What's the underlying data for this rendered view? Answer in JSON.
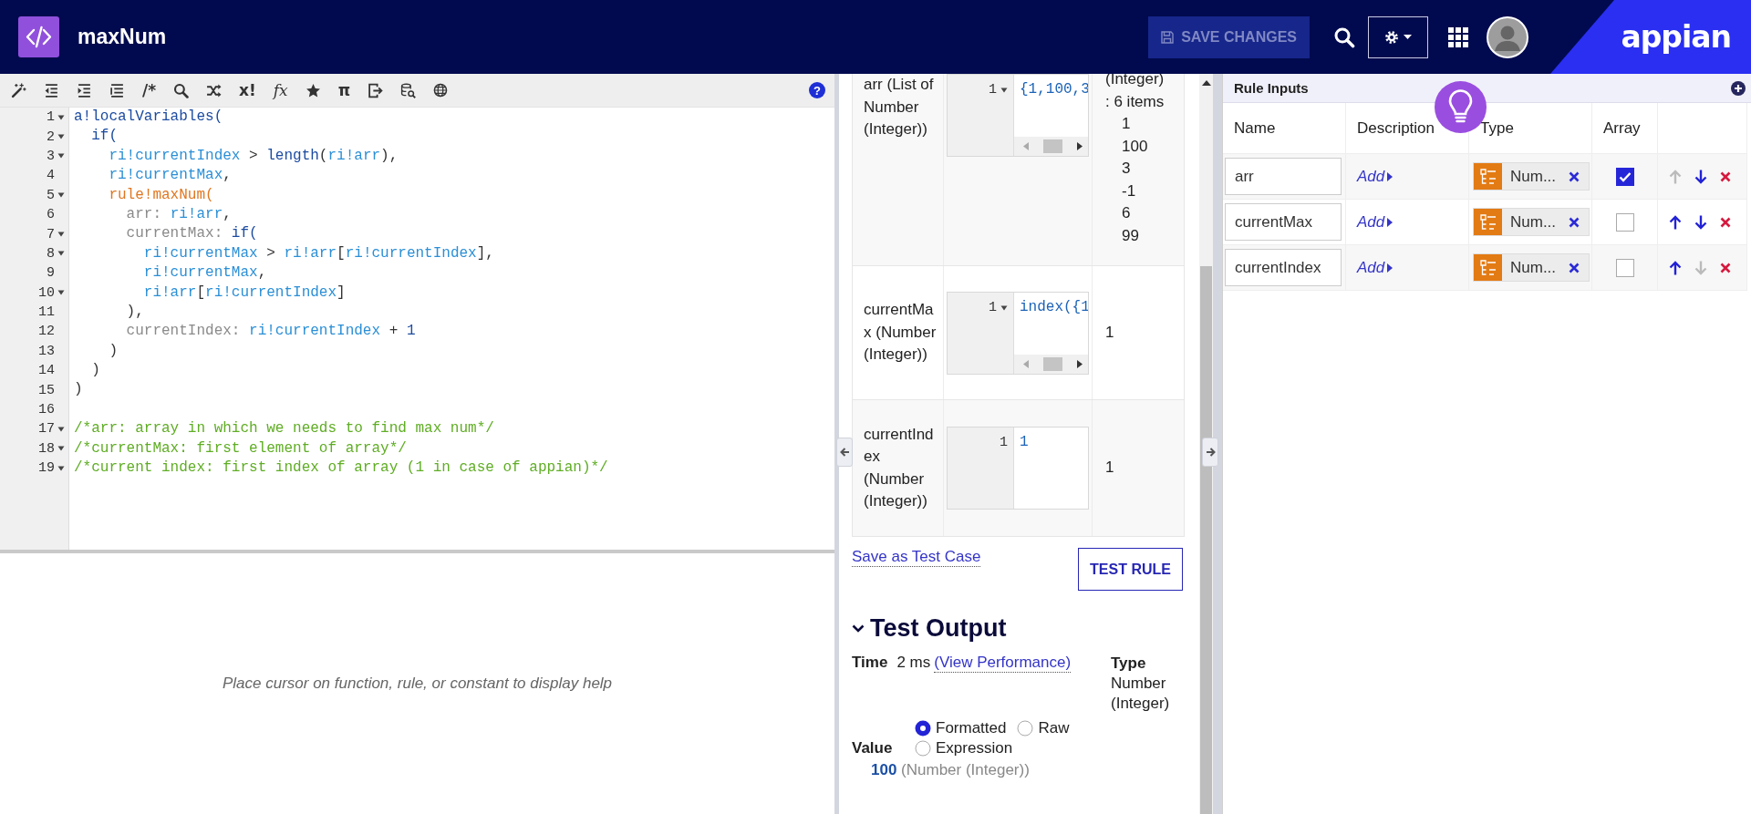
{
  "header": {
    "title": "maxNum",
    "save_button": {
      "label": "SAVE CHANGES",
      "disabled": true
    },
    "logo": "appian"
  },
  "toolbar": {
    "items": [
      {
        "kind": "icon"
      },
      {
        "kind": "icon"
      },
      {
        "kind": "icon"
      },
      {
        "kind": "icon"
      },
      {
        "kind": "glyph",
        "text": "/*"
      },
      {
        "kind": "icon"
      },
      {
        "kind": "icon"
      },
      {
        "kind": "glyph",
        "text": "x!"
      },
      {
        "kind": "glyph",
        "text": "fx"
      },
      {
        "kind": "icon"
      },
      {
        "kind": "glyph",
        "text": "π"
      },
      {
        "kind": "icon"
      },
      {
        "kind": "icon"
      },
      {
        "kind": "icon"
      }
    ],
    "help": "?"
  },
  "code_lines": [
    {
      "number": "1",
      "fold": true,
      "tokens": [
        {
          "kind": "func",
          "text": "a!localVariables("
        }
      ]
    },
    {
      "number": "2",
      "fold": true,
      "tokens": [
        {
          "kind": "func",
          "text": "  if("
        }
      ]
    },
    {
      "number": "3",
      "fold": true,
      "tokens": [
        {
          "kind": "var",
          "text": "    ri!currentIndex"
        },
        {
          "kind": "plain",
          "text": " > "
        },
        {
          "kind": "func",
          "text": "length"
        },
        {
          "kind": "plain",
          "text": "("
        },
        {
          "kind": "var",
          "text": "ri!arr"
        },
        {
          "kind": "plain",
          "text": "),"
        }
      ]
    },
    {
      "number": "4",
      "fold": false,
      "tokens": [
        {
          "kind": "var",
          "text": "    ri!currentMax"
        },
        {
          "kind": "plain",
          "text": ","
        }
      ]
    },
    {
      "number": "5",
      "fold": true,
      "tokens": [
        {
          "kind": "rule",
          "text": "    rule!maxNum("
        }
      ]
    },
    {
      "number": "6",
      "fold": false,
      "tokens": [
        {
          "kind": "param",
          "text": "      arr: "
        },
        {
          "kind": "var",
          "text": "ri!arr"
        },
        {
          "kind": "plain",
          "text": ","
        }
      ]
    },
    {
      "number": "7",
      "fold": true,
      "tokens": [
        {
          "kind": "param",
          "text": "      currentMax: "
        },
        {
          "kind": "func",
          "text": "if("
        }
      ]
    },
    {
      "number": "8",
      "fold": true,
      "tokens": [
        {
          "kind": "var",
          "text": "        ri!currentMax"
        },
        {
          "kind": "plain",
          "text": " > "
        },
        {
          "kind": "var",
          "text": "ri!arr"
        },
        {
          "kind": "plain",
          "text": "["
        },
        {
          "kind": "var",
          "text": "ri!currentIndex"
        },
        {
          "kind": "plain",
          "text": "],"
        }
      ]
    },
    {
      "number": "9",
      "fold": false,
      "tokens": [
        {
          "kind": "var",
          "text": "        ri!currentMax"
        },
        {
          "kind": "plain",
          "text": ","
        }
      ]
    },
    {
      "number": "10",
      "fold": true,
      "tokens": [
        {
          "kind": "var",
          "text": "        ri!arr"
        },
        {
          "kind": "plain",
          "text": "["
        },
        {
          "kind": "var",
          "text": "ri!currentIndex"
        },
        {
          "kind": "plain",
          "text": "]"
        }
      ]
    },
    {
      "number": "11",
      "fold": false,
      "tokens": [
        {
          "kind": "plain",
          "text": "      ),"
        }
      ]
    },
    {
      "number": "12",
      "fold": false,
      "tokens": [
        {
          "kind": "param",
          "text": "      currentIndex: "
        },
        {
          "kind": "var",
          "text": "ri!currentIndex"
        },
        {
          "kind": "plain",
          "text": " + "
        },
        {
          "kind": "num",
          "text": "1"
        }
      ]
    },
    {
      "number": "13",
      "fold": false,
      "tokens": [
        {
          "kind": "plain",
          "text": "    )"
        }
      ]
    },
    {
      "number": "14",
      "fold": false,
      "tokens": [
        {
          "kind": "plain",
          "text": "  )"
        }
      ]
    },
    {
      "number": "15",
      "fold": false,
      "tokens": [
        {
          "kind": "plain",
          "text": ")"
        }
      ]
    },
    {
      "number": "16",
      "fold": false
    },
    {
      "number": "17",
      "fold": true,
      "tokens": [
        {
          "kind": "comment",
          "text": "/*arr: array in which we needs to find max num*/"
        }
      ]
    },
    {
      "number": "18",
      "fold": true,
      "tokens": [
        {
          "kind": "comment",
          "text": "/*currentMax: first element of array*/"
        }
      ]
    },
    {
      "number": "19",
      "fold": true,
      "tokens": [
        {
          "kind": "comment",
          "text": "/*current index: first index of array (1 in case of appian)*/"
        }
      ]
    }
  ],
  "help_text": "Place cursor on function, rule, or constant to display help",
  "test_inputs": [
    {
      "label": "arr (List of Number (Integer))",
      "editor": {
        "line_number": "1",
        "fold": true,
        "code": "{1,100,3",
        "h_scrollbar": true
      },
      "result": {
        "lines": [
          "(Integer)",
          ": 6 items"
        ],
        "items": [
          "1",
          "100",
          "3",
          "-1",
          "6",
          "99"
        ]
      }
    },
    {
      "label": "currentMax (Number (Integer))",
      "editor": {
        "line_number": "1",
        "fold": true,
        "code": "index({1",
        "h_scrollbar": true
      },
      "result": {
        "lines": [
          "1"
        ]
      }
    },
    {
      "label": "currentIndex (Number (Integer))",
      "editor": {
        "line_number": "1",
        "fold": false,
        "code": "1",
        "h_scrollbar": false
      },
      "result": {
        "lines": [
          "1"
        ]
      }
    }
  ],
  "save_test_case": "Save as Test Case",
  "test_rule": "TEST RULE",
  "test_output": {
    "title": "Test Output",
    "expanded": true,
    "time_label": "Time",
    "time": "2 ms",
    "performance_link": "(View Performance)",
    "type_label": "Type",
    "type": "Number (Integer)",
    "value_label": "Value",
    "formats": [
      {
        "label": "Formatted",
        "selected": true
      },
      {
        "label": "Raw",
        "selected": false
      },
      {
        "label": "Expression",
        "selected": false
      }
    ],
    "value": "100",
    "value_type": "(Number (Integer))"
  },
  "rule_inputs": {
    "title": "Rule Inputs",
    "columns": [
      "Name",
      "Description",
      "Type",
      "Array"
    ],
    "rows": [
      {
        "name": "arr",
        "description": "Add",
        "type": "Num...",
        "array": true,
        "up_enabled": false,
        "down_enabled": true
      },
      {
        "name": "currentMax",
        "description": "Add",
        "type": "Num...",
        "array": false,
        "up_enabled": true,
        "down_enabled": true
      },
      {
        "name": "currentIndex",
        "description": "Add",
        "type": "Num...",
        "array": false,
        "up_enabled": true,
        "down_enabled": false
      }
    ]
  }
}
